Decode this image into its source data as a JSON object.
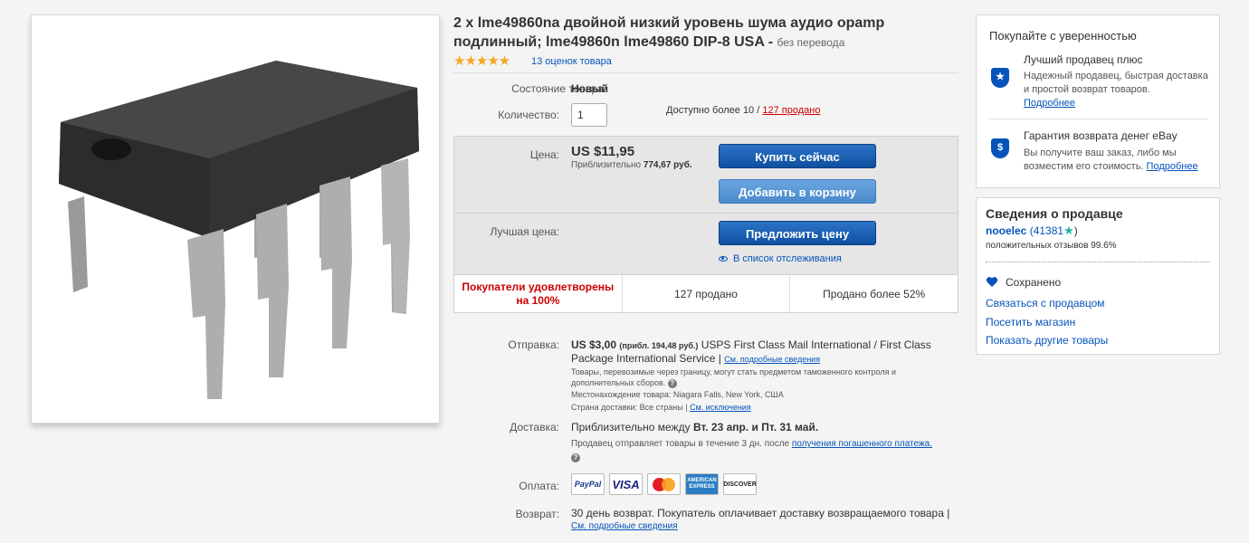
{
  "product": {
    "title": "2 x lme49860na двойной низкий уровень шума аудио opamp подлинный; lme49860n lme49860 DIP-8 USA -",
    "title_suffix": "без перевода",
    "stars": "★★★★★",
    "ratings_count": "13 оценок товара",
    "condition_label": "Состояние товара:",
    "condition_value": "Новый",
    "quantity_label": "Количество:",
    "quantity_value": "1",
    "availability_text": "Доступно более 10 /",
    "sold_link": "127 продано"
  },
  "buy_box": {
    "price_label": "Цена:",
    "price": "US $11,95",
    "approx_prefix": "Приблизительно",
    "approx_value": "774,67 руб.",
    "buy_now": "Купить сейчас",
    "add_to_cart": "Добавить в корзину",
    "best_offer_label": "Лучшая цена:",
    "make_offer": "Предложить цену",
    "watchlist": "В список отслеживания",
    "stat_satisfied": "Покупатели удовлетворены на 100%",
    "stat_sold": "127 продано",
    "stat_sold_pct": "Продано более 52%"
  },
  "shipping": {
    "label": "Отправка:",
    "cost": "US $3,00",
    "cost_approx": "(прибл. 194,48 руб.)",
    "service": "USPS First Class Mail International / First Class Package International Service |",
    "details_link": "См. подробные сведения",
    "customs_note": "Товары, перевозимые через границу, могут стать предметом таможенного контроля и дополнительных сборов.",
    "location": "Местонахождение товара:  Niagara Falls, New York, США",
    "countries_prefix": "Страна доставки:  Все страны  |",
    "exclusions_link": "См. исключения"
  },
  "delivery": {
    "label": "Доставка:",
    "estimate_prefix": "Приблизительно между",
    "estimate_dates": "Вт. 23 апр. и Пт. 31 май.",
    "handling": "Продавец отправляет товары в течение 3 дн. после",
    "handling_link": "получения погашенного платежа."
  },
  "payment": {
    "label": "Оплата:",
    "cards": [
      "PayPal",
      "VISA",
      "MasterCard",
      "AMERICAN EXPRESS",
      "DISCOVER"
    ]
  },
  "returns": {
    "label": "Возврат:",
    "text": "30 день возврат. Покупатель оплачивает доставку возвращаемого товара |",
    "details_link": "См. подробные сведения"
  },
  "confidence": {
    "heading": "Покупайте с уверенностью",
    "top_seller_title": "Лучший продавец плюс",
    "top_seller_text": "Надежный продавец, быстрая доставка и простой возврат товаров.",
    "top_seller_link": "Подробнее",
    "guarantee_title": "Гарантия возврата денег eBay",
    "guarantee_text": "Вы получите ваш заказ, либо мы возместим его стоимость.",
    "guarantee_link": "Подробнее"
  },
  "seller": {
    "heading": "Сведения о продавце",
    "name": "nooelec",
    "feedback_open": "(41381",
    "feedback_close": ")",
    "positive": "положительных отзывов 99.6%",
    "saved": "Сохранено",
    "contact": "Связаться с продавцом",
    "visit_store": "Посетить магазин",
    "other_items": "Показать другие товары"
  },
  "colors": {
    "link": "#0654ba",
    "button_primary": "#0f4fa0",
    "star": "#f5a623",
    "alert_red": "#cc0000"
  }
}
